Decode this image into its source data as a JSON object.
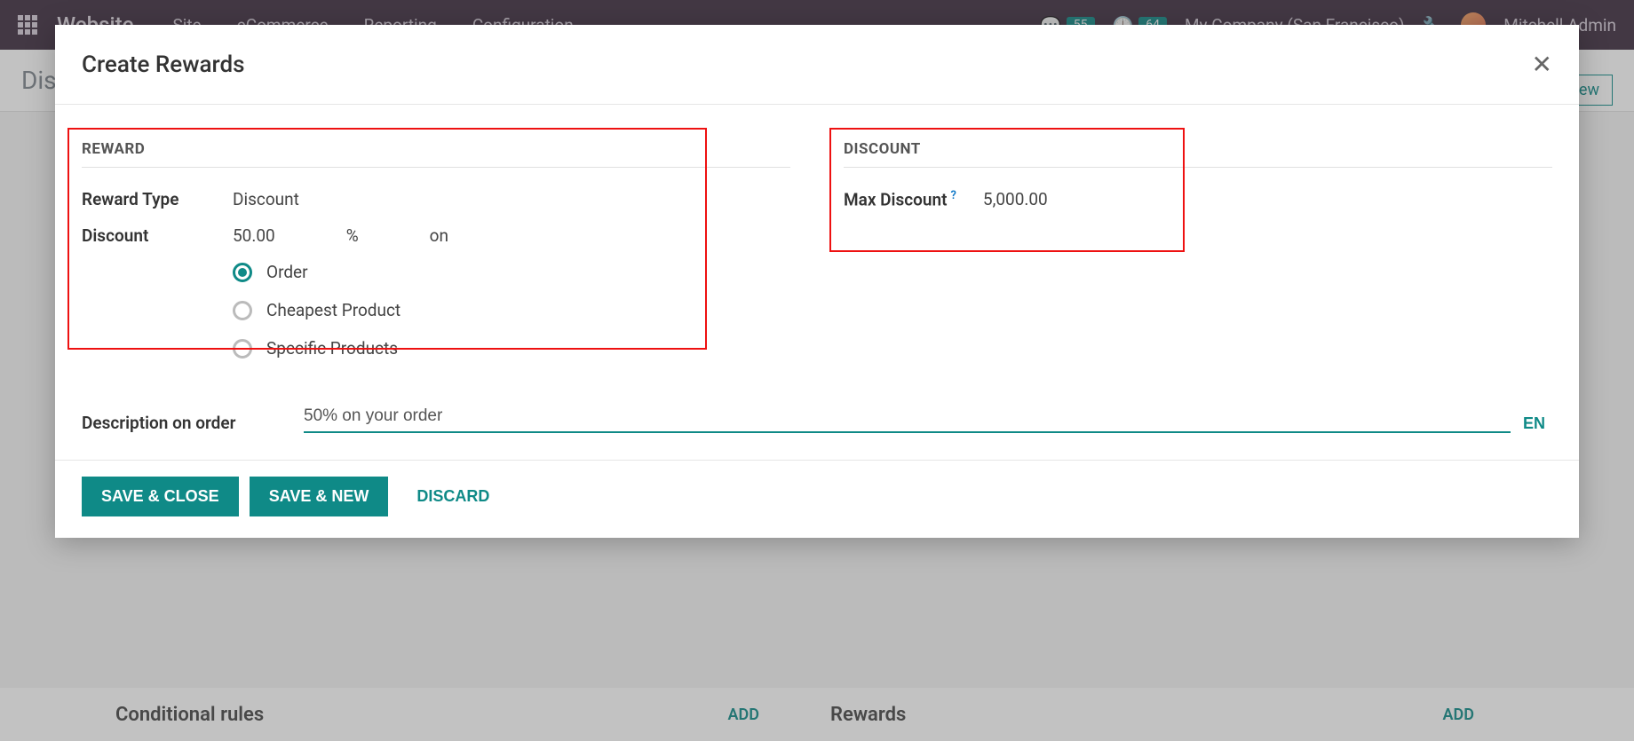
{
  "nav": {
    "brand": "Website",
    "links": [
      "Site",
      "eCommerce",
      "Reporting",
      "Configuration"
    ],
    "messages_count": "55",
    "activities_count": "64",
    "company": "My Company (San Francisco)",
    "user": "Mitchell Admin"
  },
  "bg": {
    "breadcrumb": "Dis",
    "new_btn_fragment": "ew",
    "bottom_left_title": "Conditional rules",
    "bottom_right_title": "Rewards",
    "add_label": "ADD"
  },
  "modal": {
    "title": "Create Rewards",
    "reward": {
      "section": "REWARD",
      "type_label": "Reward Type",
      "type_value": "Discount",
      "discount_label": "Discount",
      "discount_value": "50.00",
      "unit": "%",
      "on": "on",
      "options": {
        "order": "Order",
        "cheapest": "Cheapest Product",
        "specific": "Specific Products"
      }
    },
    "discount": {
      "section": "DISCOUNT",
      "max_label": "Max Discount",
      "help": "?",
      "max_value": "5,000.00"
    },
    "desc": {
      "label": "Description on order",
      "value": "50% on your order",
      "lang": "EN"
    },
    "footer": {
      "save_close": "SAVE & CLOSE",
      "save_new": "SAVE & NEW",
      "discard": "DISCARD"
    }
  }
}
